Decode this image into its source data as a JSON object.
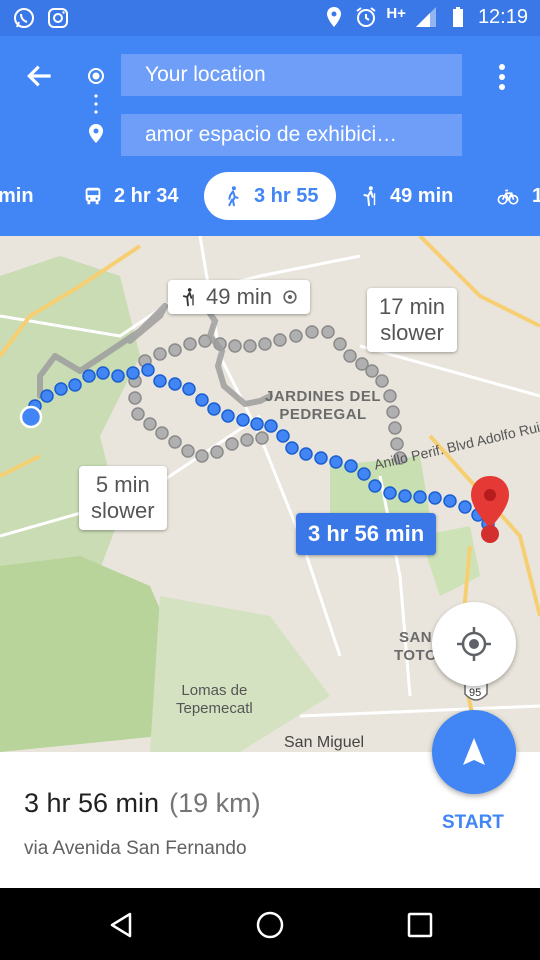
{
  "status_bar": {
    "time": "12:19",
    "network": "H+",
    "icons": [
      "whatsapp-icon",
      "instagram-icon",
      "location-icon",
      "alarm-icon",
      "signal-icon",
      "battery-icon"
    ]
  },
  "directions": {
    "origin": "Your location",
    "destination": "amor espacio de exhibici…"
  },
  "tabs": [
    {
      "icon": "car-icon",
      "label": "min"
    },
    {
      "icon": "bus-icon",
      "label": "2 hr 34"
    },
    {
      "icon": "walk-icon",
      "label": "3 hr 55"
    },
    {
      "icon": "rideshare-icon",
      "label": "49 min"
    },
    {
      "icon": "bike-icon",
      "label": "1"
    }
  ],
  "map": {
    "callouts": {
      "rideshare": "49 min",
      "alt1_line1": "17 min",
      "alt1_line2": "slower",
      "alt2_line1": "5 min",
      "alt2_line2": "slower",
      "selected": "3 hr 56 min"
    },
    "labels": {
      "jardines_line1": "JARDINES DEL",
      "jardines_line2": "PEDREGAL",
      "road": "Anillo Perif. Blvd Adolfo Ruiz",
      "santo_line1": "SAN",
      "santo_line2": "TOTO",
      "lomas_line1": "Lomas de",
      "lomas_line2": "Tepemecatl",
      "san_miguel": "San Miguel",
      "shield": "95"
    }
  },
  "summary": {
    "duration": "3 hr 56 min",
    "distance": "(19 km)",
    "via": "via Avenida San Fernando",
    "start_label": "START"
  },
  "colors": {
    "status_bar": "#3b78e7",
    "app_bar": "#4285f4",
    "field": "#6e9ef7",
    "route_selected": "#4285f4",
    "route_alt": "#9e9e9e",
    "destination_pin": "#e53935"
  }
}
